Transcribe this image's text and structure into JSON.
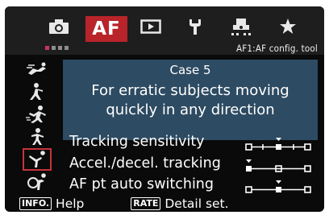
{
  "tabs": [
    {
      "name": "shooting",
      "icon": "camera-icon"
    },
    {
      "name": "af",
      "label": "AF"
    },
    {
      "name": "playback",
      "icon": "playback-icon"
    },
    {
      "name": "setup",
      "icon": "wrench-icon"
    },
    {
      "name": "custom-functions",
      "icon": "custom-functions-icon"
    },
    {
      "name": "my-menu",
      "icon": "star-icon"
    }
  ],
  "sub_bar": {
    "page_dots": 4,
    "active_dot": 1,
    "menu_title": "AF1:AF config. tool"
  },
  "case_list": {
    "selected_case": 5,
    "icons": [
      "case1-icon",
      "case2-icon",
      "case3-icon",
      "case4-icon",
      "case5-icon",
      "case6-icon"
    ]
  },
  "description": {
    "case_title": "Case 5",
    "line1": "For erratic subjects moving",
    "line2": "quickly in any direction"
  },
  "params": [
    {
      "label": "Tracking sensitivity",
      "scale": "five-level",
      "value": 0
    },
    {
      "label": "Accel./decel. tracking",
      "scale": "three-level",
      "value": 0
    },
    {
      "label": "AF pt auto switching",
      "scale": "three-level",
      "value": 1
    }
  ],
  "footer": {
    "info_key": "INFO.",
    "info_label": "Help",
    "rate_key": "RATE",
    "rate_label": "Detail set."
  },
  "colors": {
    "active_tab": "#b8242a",
    "panel": "#2d4b62",
    "active_dot": "#c9345e",
    "selection": "#c6343a"
  }
}
